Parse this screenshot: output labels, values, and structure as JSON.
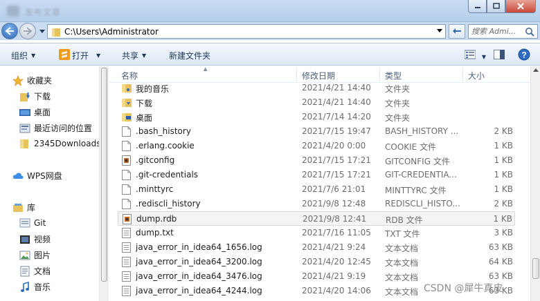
{
  "window": {
    "title": "发布文章"
  },
  "address": {
    "path": "C:\\Users\\Administrator",
    "search_placeholder": "搜索 Admi..."
  },
  "toolbar": {
    "organize": "组织",
    "open": "打开",
    "share": "共享",
    "new_folder": "新建文件夹"
  },
  "nav": {
    "favorites": "收藏夹",
    "downloads": "下载",
    "desktop": "桌面",
    "recent": "最近访问的位置",
    "folder2345": "2345Downloads",
    "wps": "WPS网盘",
    "libraries": "库",
    "git": "Git",
    "videos": "视频",
    "pictures": "图片",
    "documents": "文档",
    "music": "音乐"
  },
  "columns": {
    "name": "名称",
    "modified": "修改日期",
    "type": "类型",
    "size": "大小"
  },
  "files": [
    {
      "name": "我的音乐",
      "date": "2021/4/21 14:40",
      "type": "文件夹",
      "size": "",
      "icon": "music-folder"
    },
    {
      "name": "下载",
      "date": "2021/4/21 14:40",
      "type": "文件夹",
      "size": "",
      "icon": "download-folder"
    },
    {
      "name": "桌面",
      "date": "2021/7/14 14:20",
      "type": "文件夹",
      "size": "",
      "icon": "desktop-folder"
    },
    {
      "name": ".bash_history",
      "date": "2021/7/15 19:47",
      "type": "BASH_HISTORY ...",
      "size": "2 KB",
      "icon": "file"
    },
    {
      "name": ".erlang.cookie",
      "date": "2021/4/20 0:00",
      "type": "COOKIE 文件",
      "size": "1 KB",
      "icon": "file"
    },
    {
      "name": ".gitconfig",
      "date": "2021/7/15 17:21",
      "type": "GITCONFIG 文件",
      "size": "1 KB",
      "icon": "config-file"
    },
    {
      "name": ".git-credentials",
      "date": "2021/7/15 17:21",
      "type": "GIT-CREDENTIA...",
      "size": "1 KB",
      "icon": "file"
    },
    {
      "name": ".minttyrc",
      "date": "2021/7/6 21:01",
      "type": "MINTTYRC 文件",
      "size": "1 KB",
      "icon": "file"
    },
    {
      "name": ".rediscli_history",
      "date": "2021/9/8 12:48",
      "type": "REDISCLI_HISTO...",
      "size": "2 KB",
      "icon": "file"
    },
    {
      "name": "dump.rdb",
      "date": "2021/9/8 12:41",
      "type": "RDB 文件",
      "size": "1 KB",
      "icon": "config-file",
      "selected": true
    },
    {
      "name": "dump.txt",
      "date": "2021/7/16 11:05",
      "type": "TXT 文件",
      "size": "3 KB",
      "icon": "text-file"
    },
    {
      "name": "java_error_in_idea64_1656.log",
      "date": "2021/4/21 9:24",
      "type": "文本文档",
      "size": "63 KB",
      "icon": "text-file"
    },
    {
      "name": "java_error_in_idea64_3200.log",
      "date": "2021/4/20 12:45",
      "type": "文本文档",
      "size": "64 KB",
      "icon": "text-file"
    },
    {
      "name": "java_error_in_idea64_3476.log",
      "date": "2021/4/21 9:19",
      "type": "文本文档",
      "size": "63 KB",
      "icon": "text-file"
    },
    {
      "name": "java_error_in_idea64_4244.log",
      "date": "2021/4/20 14:06",
      "type": "文本文档",
      "size": "63 KB",
      "icon": "text-file"
    }
  ],
  "watermark": "CSDN @犀牛真皮",
  "colors": {
    "titlebar": "#c7dcf2",
    "toolbar_text": "#1e395b",
    "folder": "#e8c25b",
    "close_button": "#c9493a"
  }
}
